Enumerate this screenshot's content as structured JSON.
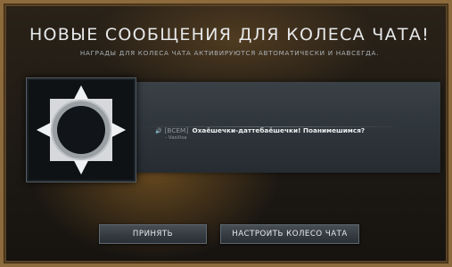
{
  "dialog": {
    "title": "НОВЫЕ СООБЩЕНИЯ ДЛЯ КОЛЕСА ЧАТА!",
    "subtitle": "НАГРАДЫ ДЛЯ КОЛЕСА ЧАТА АКТИВИРУЮТСЯ АВТОМАТИЧЕСКИ И НАВСЕГДА."
  },
  "reward": {
    "icon": "chat-wheel-star-ring-icon",
    "speaker_icon": "speaker-icon",
    "chat_prefix": "[ВСЕМ]",
    "chat_message": "Охаёшечки-даттебаёшечки! Поанимешимся?",
    "author": "- Vasilisa"
  },
  "buttons": {
    "accept": "ПРИНЯТЬ",
    "configure": "НАСТРОИТЬ КОЛЕСО ЧАТА"
  },
  "colors": {
    "frame_gold": "#8c6a3c",
    "banner": "#30373c",
    "text": "#e6e8ea"
  }
}
